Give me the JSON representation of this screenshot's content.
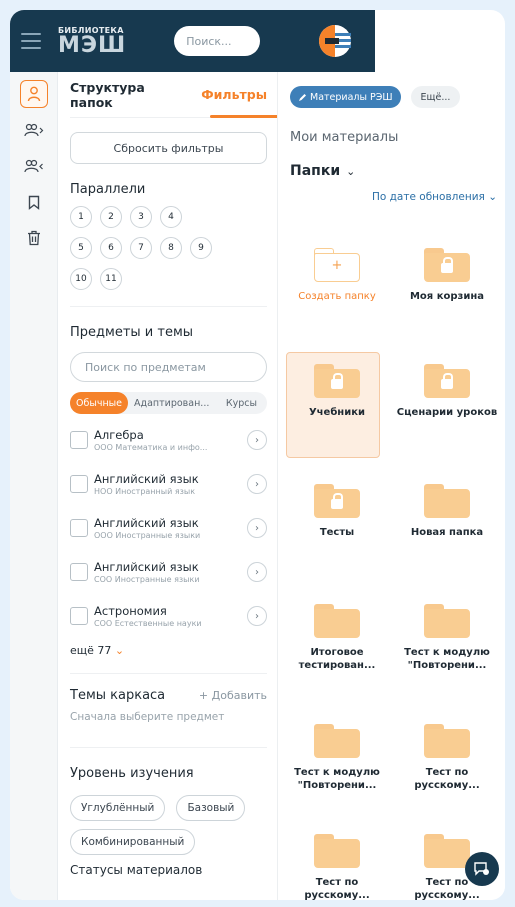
{
  "header": {
    "logo_small": "БИБЛИОТЕКА",
    "logo_big": "МЭШ",
    "search_placeholder": "Поиск..."
  },
  "rail": {
    "icons": [
      "user-icon",
      "users-shared-out-icon",
      "users-shared-in-icon",
      "bookmark-icon",
      "trash-icon"
    ]
  },
  "filters": {
    "tab_structure": "Структура папок",
    "tab_filters": "Фильтры",
    "reset_label": "Сбросить фильтры",
    "grades_title": "Параллели",
    "grades": [
      [
        "1",
        "2",
        "3",
        "4"
      ],
      [
        "5",
        "6",
        "7",
        "8",
        "9"
      ],
      [
        "10",
        "11"
      ]
    ],
    "subjects_title": "Предметы и темы",
    "subject_search_placeholder": "Поиск по предметам",
    "seg_ordinary": "Обычные",
    "seg_adapted": "Адаптирован...",
    "seg_courses": "Курсы",
    "subjects": [
      {
        "name": "Алгебра",
        "sub": "ООО Математика и инфо..."
      },
      {
        "name": "Английский язык",
        "sub": "НОО Иностранный язык"
      },
      {
        "name": "Английский язык",
        "sub": "ООО Иностранные языки"
      },
      {
        "name": "Английский язык",
        "sub": "СОО Иностранные языки"
      },
      {
        "name": "Астрономия",
        "sub": "СОО Естественные науки"
      }
    ],
    "more_label": "ещё 77",
    "frame_topics_title": "Темы каркаса",
    "add_label": "+ Добавить",
    "frame_hint": "Сначала выберите предмет",
    "level_title": "Уровень изучения",
    "level_advanced": "Углублённый",
    "level_basic": "Базовый",
    "level_combined": "Комбинированный",
    "statuses_title": "Статусы материалов"
  },
  "content": {
    "tag_primary": "Материалы РЭШ",
    "tag_more": "Ещё...",
    "crumb": "Мои материалы",
    "folders_title": "Папки",
    "sort_label": "По дате обновления",
    "folders": [
      {
        "label": "Создать папку",
        "kind": "new"
      },
      {
        "label": "Моя корзина",
        "kind": "locked"
      },
      {
        "label": "Учебники",
        "kind": "locked",
        "selected": true
      },
      {
        "label": "Сценарии уроков",
        "kind": "locked"
      },
      {
        "label": "Тесты",
        "kind": "locked"
      },
      {
        "label": "Новая папка",
        "kind": "plain"
      },
      {
        "label": "Итоговое тестирован...",
        "kind": "plain"
      },
      {
        "label": "Тест к модулю \"Повторени...",
        "kind": "plain"
      },
      {
        "label": "Тест к модулю \"Повторени...",
        "kind": "plain"
      },
      {
        "label": "Тест по русскому...",
        "kind": "plain"
      },
      {
        "label": "Тест по русскому...",
        "kind": "plain"
      },
      {
        "label": "Тест по русскому...",
        "kind": "plain"
      }
    ]
  },
  "colors": {
    "accent": "#f5822a",
    "header_bg": "#17394f",
    "folder": "#f9cd92",
    "tag_blue": "#3e7fb8"
  }
}
